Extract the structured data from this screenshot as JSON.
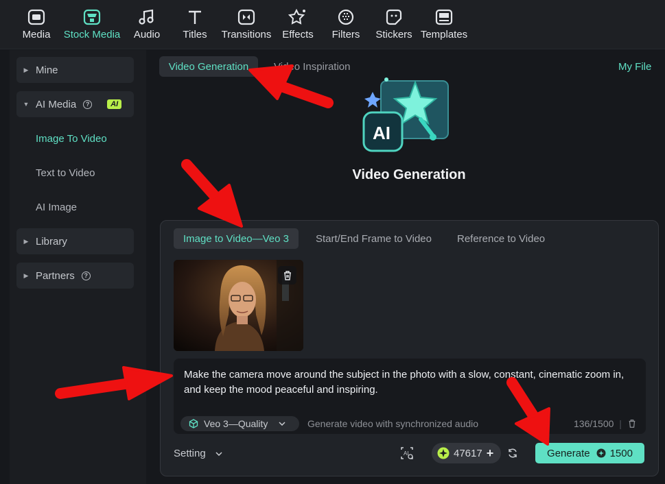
{
  "toolbar": {
    "items": [
      {
        "label": "Media",
        "icon": "media-icon"
      },
      {
        "label": "Stock Media",
        "icon": "stock-media-icon",
        "active": true
      },
      {
        "label": "Audio",
        "icon": "music-note-icon"
      },
      {
        "label": "Titles",
        "icon": "title-t-icon"
      },
      {
        "label": "Transitions",
        "icon": "transitions-icon"
      },
      {
        "label": "Effects",
        "icon": "effects-star-icon"
      },
      {
        "label": "Filters",
        "icon": "filters-icon"
      },
      {
        "label": "Stickers",
        "icon": "stickers-icon"
      },
      {
        "label": "Templates",
        "icon": "templates-icon"
      }
    ],
    "active_color": "#5fe0c4"
  },
  "sidebar": {
    "mine": "Mine",
    "ai_media": "AI Media",
    "ai_badge": "AI",
    "sub_items": [
      "Image To Video",
      "Text to Video",
      "AI Image"
    ],
    "active_sub": "Image To Video",
    "library": "Library",
    "partners": "Partners"
  },
  "tabs": {
    "video_generation": "Video Generation",
    "video_inspiration": "Video Inspiration",
    "my_file": "My File"
  },
  "hero": {
    "icon_label": "AI",
    "title": "Video Generation"
  },
  "panel": {
    "modes": [
      "Image to Video—Veo 3",
      "Start/End Frame to Video",
      "Reference to Video"
    ],
    "active_mode": "Image to Video—Veo 3",
    "prompt": "Make the camera move around the subject in the photo with a slow, constant, cinematic zoom in, and keep the mood peaceful and inspiring.",
    "model": "Veo 3—Quality",
    "model_description": "Generate video with synchronized audio",
    "char_count": "136/1500",
    "setting_label": "Setting",
    "credits": "47617",
    "generate_label": "Generate",
    "generate_cost": "1500"
  },
  "colors": {
    "accent": "#5fe0c4",
    "ai_badge": "#b9ef4a",
    "annotation_arrow": "#ee1111"
  }
}
